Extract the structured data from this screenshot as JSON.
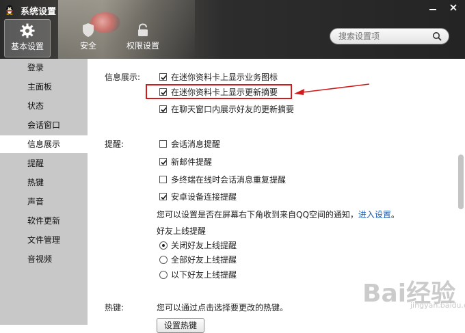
{
  "window": {
    "title": "系统设置",
    "minimize_icon": "minimize-icon",
    "close_icon": "close-icon"
  },
  "top_tabs": [
    {
      "label": "基本设置",
      "icon": "gear-icon",
      "active": true
    },
    {
      "label": "安全",
      "icon": "shield-icon",
      "active": false
    },
    {
      "label": "权限设置",
      "icon": "lock-icon",
      "active": false
    }
  ],
  "search": {
    "placeholder": "搜索设置项"
  },
  "sidebar": {
    "items": [
      {
        "label": "登录"
      },
      {
        "label": "主面板"
      },
      {
        "label": "状态"
      },
      {
        "label": "会话窗口"
      },
      {
        "label": "信息展示",
        "active": true
      },
      {
        "label": "提醒"
      },
      {
        "label": "热键"
      },
      {
        "label": "声音"
      },
      {
        "label": "软件更新"
      },
      {
        "label": "文件管理"
      },
      {
        "label": "音视频"
      }
    ]
  },
  "info_section": {
    "label": "信息展示:",
    "options": [
      {
        "label": "在迷你资料卡上显示业务图标",
        "checked": true
      },
      {
        "label": "在迷你资料卡上显示更新摘要",
        "checked": true,
        "highlighted": true
      },
      {
        "label": "在聊天窗口内展示好友的更新摘要",
        "checked": true
      }
    ]
  },
  "reminder_section": {
    "label": "提醒:",
    "options": [
      {
        "label": "会话消息提醒",
        "checked": false
      },
      {
        "label": "新邮件提醒",
        "checked": true
      },
      {
        "label": "多终端在线时会话消息重复提醒",
        "checked": false
      },
      {
        "label": "安卓设备连接提醒",
        "checked": true
      }
    ],
    "note": "您可以设置是否在屏幕右下角收到来自QQ空间的通知，",
    "note_link": "进入设置",
    "note_end": "。",
    "friend_online_label": "好友上线提醒",
    "friend_online_options": [
      {
        "label": "关闭好友上线提醒",
        "selected": true
      },
      {
        "label": "全部好友上线提醒",
        "selected": false
      },
      {
        "label": "以下好友上线提醒",
        "selected": false
      }
    ]
  },
  "hotkey_section": {
    "label": "热键:",
    "description": "您可以通过点击选择要更改的热键。",
    "button": "设置热键"
  },
  "annotation": {
    "color": "#d21a1a"
  },
  "watermark": {
    "logo_text": "Bai经验",
    "url": "jingyan.baidu.com"
  },
  "colors": {
    "sidebar_bg": "#c8c8c8",
    "link": "#1a5fb4",
    "titlebar": "#2d2d2d"
  }
}
